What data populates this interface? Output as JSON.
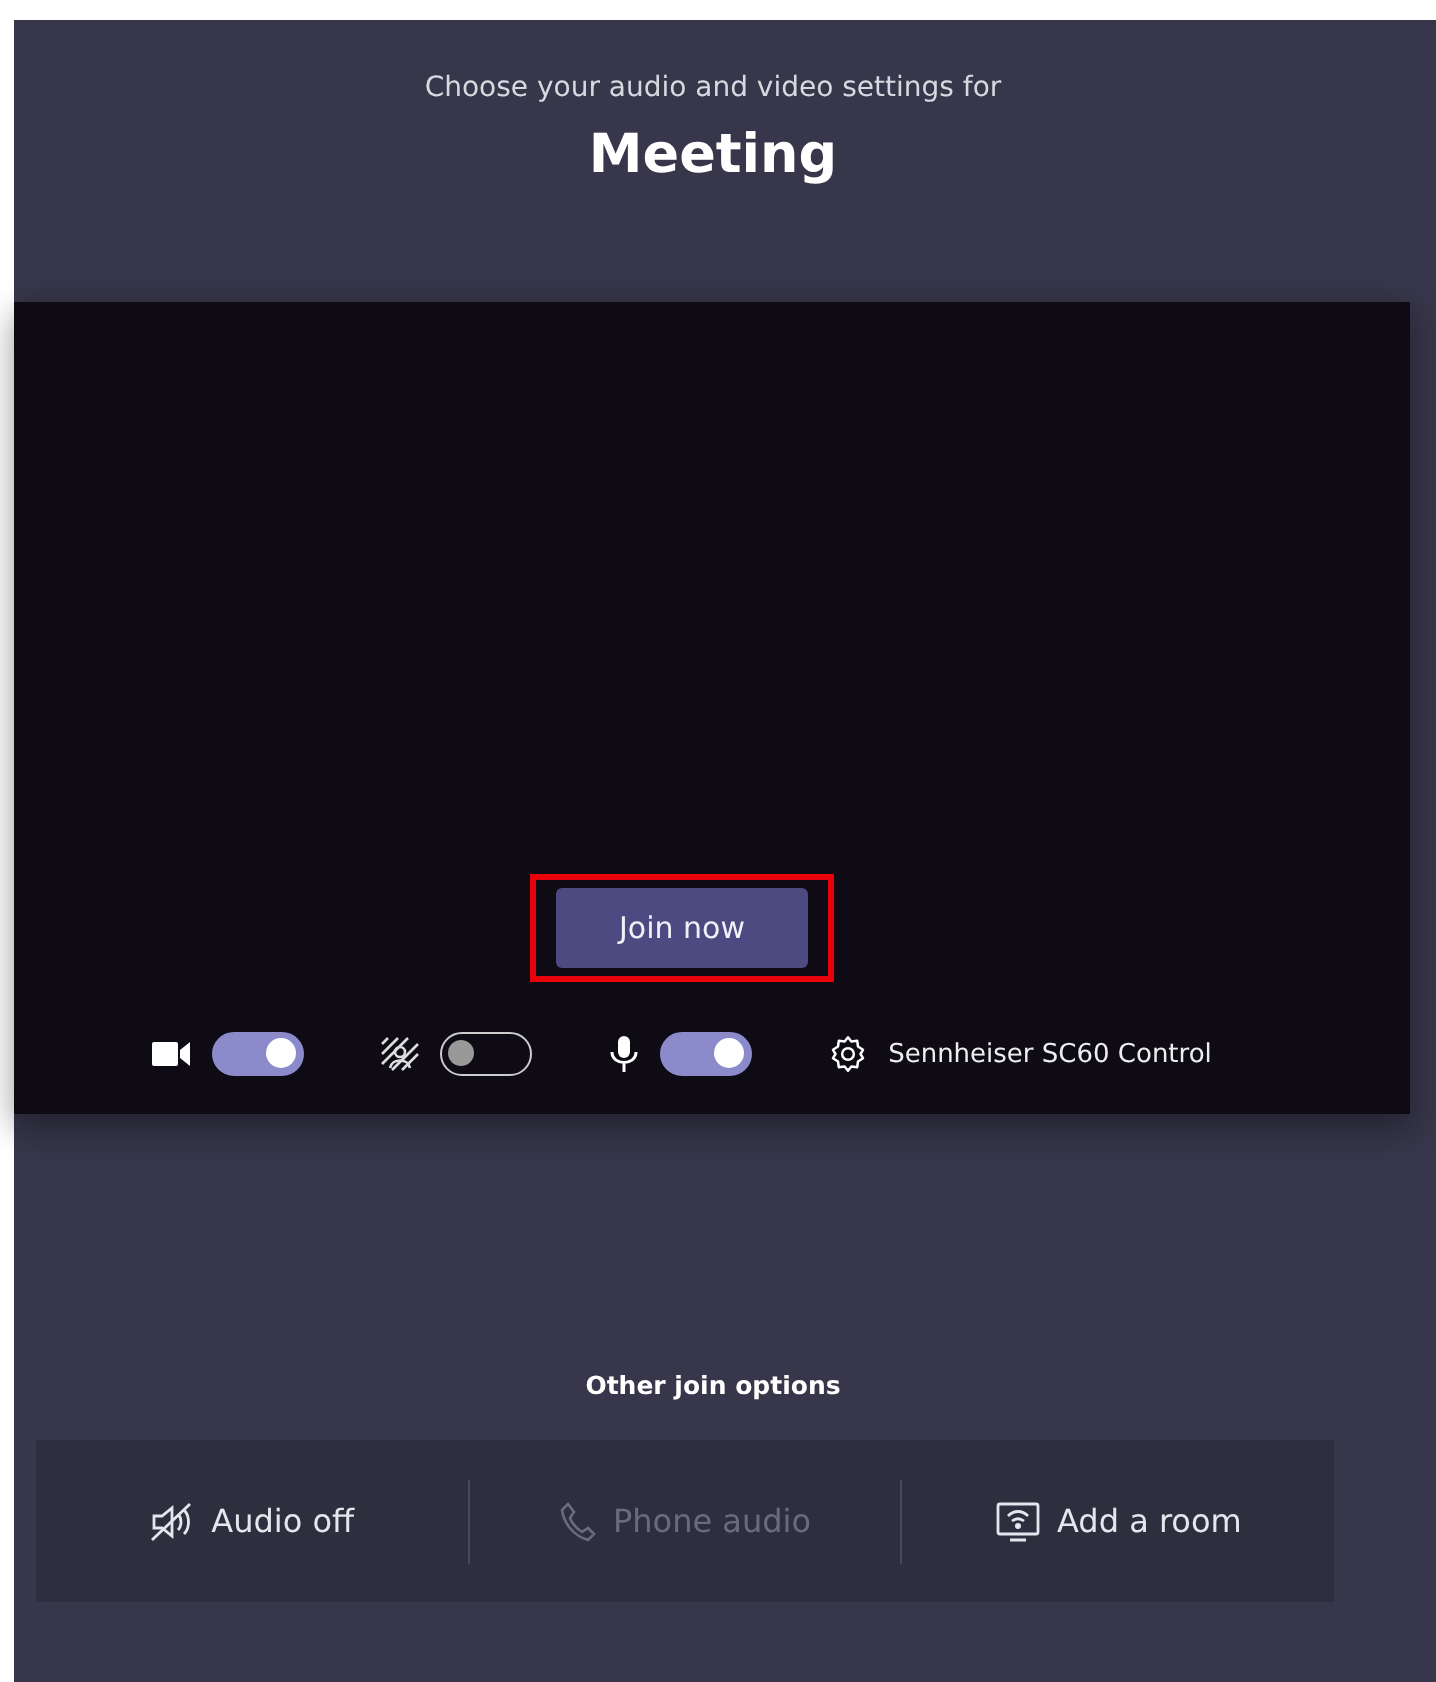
{
  "header": {
    "subtitle": "Choose your audio and video settings for",
    "title": "Meeting"
  },
  "preview": {
    "join_button": {
      "label": "Join now",
      "highlighted": true
    },
    "controls": [
      {
        "kind": "camera",
        "on": true
      },
      {
        "kind": "background",
        "on": false
      },
      {
        "kind": "mic",
        "on": true
      }
    ],
    "device": {
      "label": "Sennheiser SC60 Control"
    }
  },
  "other_options": {
    "title": "Other join options",
    "items": [
      {
        "kind": "audio-off",
        "label": "Audio off",
        "disabled": false
      },
      {
        "kind": "phone",
        "label": "Phone audio",
        "disabled": true
      },
      {
        "kind": "room",
        "label": "Add a room",
        "disabled": false
      }
    ]
  }
}
